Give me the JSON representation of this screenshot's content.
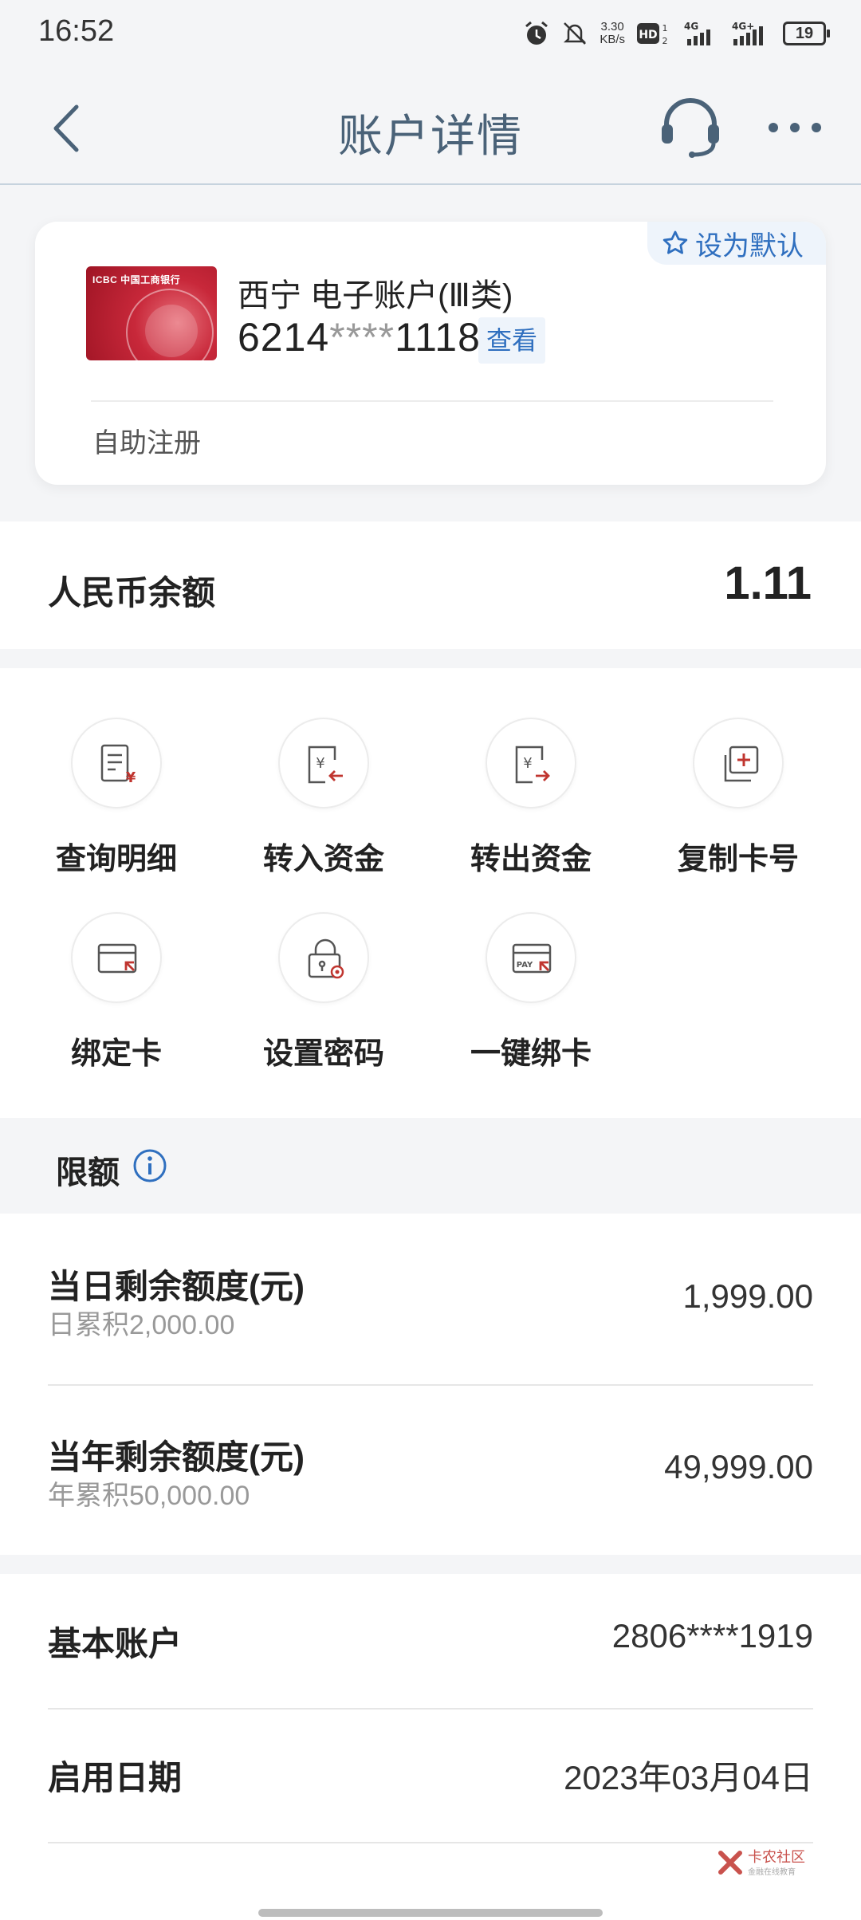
{
  "status_bar": {
    "time": "16:52",
    "speed_value": "3.30",
    "speed_unit": "KB/s",
    "hd_label": "HD",
    "network_1": "4G",
    "network_2": "4G⁺",
    "battery": "19"
  },
  "nav": {
    "title": "账户详情",
    "back_icon": "back-arrow-icon",
    "support_icon": "headset-icon",
    "more_icon": "more-dots-icon"
  },
  "card": {
    "default_label": "设为默认",
    "bank_logo_text": "ICBC 中国工商银行",
    "account_name": "西宁  电子账户(Ⅲ类)",
    "number_prefix": "6214",
    "number_mask": "****",
    "number_suffix": "1118",
    "view_label": "查看",
    "self_register": "自助注册"
  },
  "balance": {
    "label": "人民币余额",
    "value": "1.11"
  },
  "actions": [
    {
      "label": "查询明细",
      "icon": "statement-icon"
    },
    {
      "label": "转入资金",
      "icon": "transfer-in-icon"
    },
    {
      "label": "转出资金",
      "icon": "transfer-out-icon"
    },
    {
      "label": "复制卡号",
      "icon": "copy-icon"
    },
    {
      "label": "绑定卡",
      "icon": "bind-card-icon"
    },
    {
      "label": "设置密码",
      "icon": "set-password-icon"
    },
    {
      "label": "一键绑卡",
      "icon": "pay-bind-icon"
    }
  ],
  "limits": {
    "title": "限额",
    "rows": [
      {
        "title": "当日剩余额度(元)",
        "sub": "日累积2,000.00",
        "value": "1,999.00"
      },
      {
        "title": "当年剩余额度(元)",
        "sub": "年累积50,000.00",
        "value": "49,999.00"
      }
    ]
  },
  "info": [
    {
      "key": "基本账户",
      "value": "2806****1919"
    },
    {
      "key": "启用日期",
      "value": "2023年03月04日"
    }
  ],
  "watermark": {
    "text": "卡农社区",
    "sub": "金融在线教育"
  },
  "colors": {
    "accent": "#2f6fbf",
    "title": "#4a6278",
    "icon_red": "#c0352f"
  }
}
